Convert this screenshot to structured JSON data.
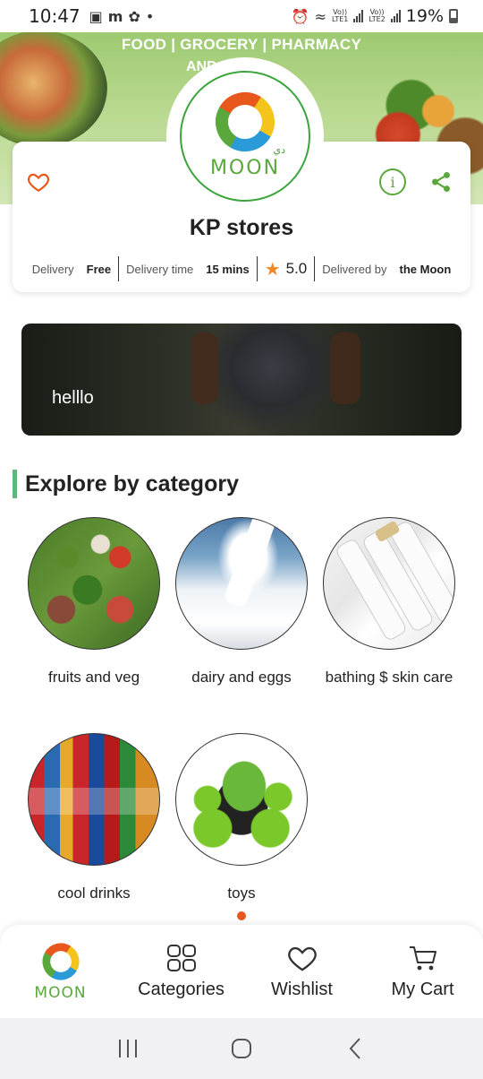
{
  "status_bar": {
    "time": "10:47",
    "left_glyphs": [
      "🖼",
      "m",
      "⊘",
      "•"
    ],
    "battery_text": "19%",
    "lte1": "Vo))\nLTE1",
    "lte2": "Vo))\nLTE2"
  },
  "banner": {
    "headline": "FOOD  |  GROCERY  |  PHARMACY",
    "headline2": "AND STORE"
  },
  "store": {
    "logo_text": "MOON",
    "logo_arabic": "دي",
    "name": "KP stores",
    "meta": {
      "delivery_label": "Delivery",
      "delivery_value": "Free",
      "time_label": "Delivery time",
      "time_value": "15 mins",
      "rating": "5.0",
      "delivered_by_label": "Delivered by",
      "delivered_by_value": "the Moon"
    }
  },
  "promo": {
    "caption": "helllo"
  },
  "section": {
    "title": "Explore by category"
  },
  "categories": [
    {
      "name": "fruits and veg",
      "icon": "vegetables"
    },
    {
      "name": "dairy and eggs",
      "icon": "milk"
    },
    {
      "name": "bathing $ skin care",
      "icon": "dove-bottles"
    },
    {
      "name": "cool drinks",
      "icon": "soda-bottles"
    },
    {
      "name": "toys",
      "icon": "toy-truck"
    }
  ],
  "bottom_nav": {
    "home_logo": "MOON",
    "categories": "Categories",
    "wishlist": "Wishlist",
    "cart": "My Cart"
  },
  "colors": {
    "accent_green": "#5aa83c",
    "heart_orange": "#e8571c",
    "star_orange": "#f0882a",
    "section_bar": "#5fb87a"
  }
}
